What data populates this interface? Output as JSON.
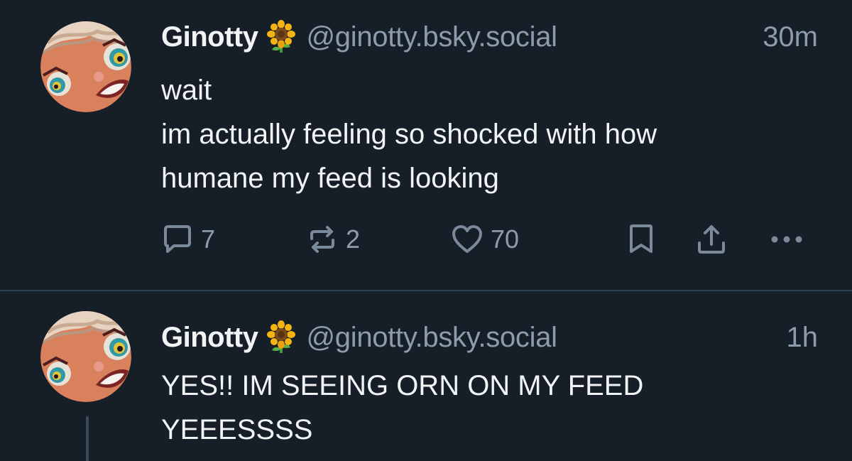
{
  "colors": {
    "background": "#161e27",
    "divider": "#2e4052",
    "text": "#f1f3f5",
    "muted": "#8d9cac",
    "icon": "#7b8a9b"
  },
  "posts": [
    {
      "display_name": "Ginotty",
      "name_emoji": "sunflower-icon",
      "handle": "@ginotty.bsky.social",
      "time": "30m",
      "lines": [
        "wait",
        "im actually feeling so shocked with how",
        "humane my feed is looking"
      ],
      "counts": {
        "replies": "7",
        "reposts": "2",
        "likes": "70"
      },
      "action_icons": [
        "reply-icon",
        "repost-icon",
        "like-heart-icon",
        "bookmark-icon",
        "share-icon",
        "more-icon"
      ]
    },
    {
      "display_name": "Ginotty",
      "name_emoji": "sunflower-icon",
      "handle": "@ginotty.bsky.social",
      "time": "1h",
      "lines": [
        "YES!! IM SEEING ORN ON MY FEED",
        "YEEESSSS"
      ]
    }
  ]
}
